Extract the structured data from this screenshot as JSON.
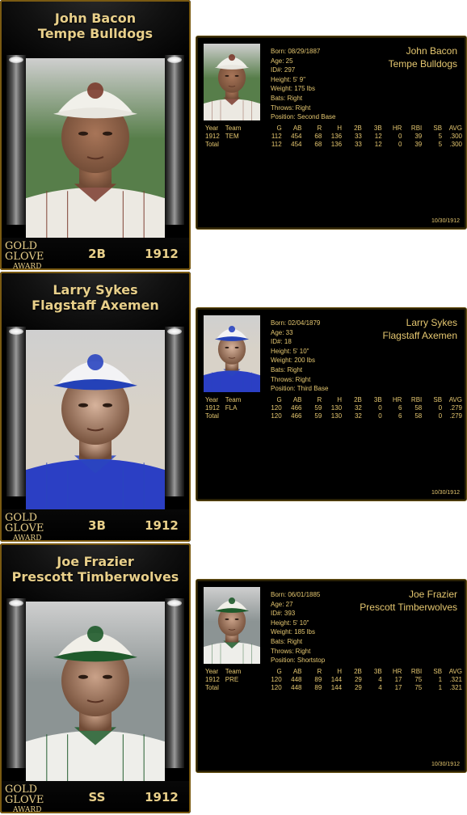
{
  "cards": [
    {
      "name": "John Bacon",
      "team": "Tempe Bulldogs",
      "position": "2B",
      "year": "1912",
      "bio": {
        "born": "Born: 08/29/1887",
        "age": "Age: 25",
        "id": "ID#: 297",
        "height": "Height: 5' 9\"",
        "weight": "Weight: 175 lbs",
        "bats": "Bats: Right",
        "throws": "Throws: Right",
        "position": "Position: Second Base"
      },
      "rows": [
        [
          "1912",
          "TEM",
          "112",
          "454",
          "68",
          "136",
          "33",
          "12",
          "0",
          "39",
          "5",
          ".300"
        ],
        [
          "Total",
          "",
          "112",
          "454",
          "68",
          "136",
          "33",
          "12",
          "0",
          "39",
          "5",
          ".300"
        ]
      ],
      "date": "10/30/1912",
      "colors": {
        "cap": "#f1f0ea",
        "brim": "#e8e6df",
        "jersey": "#ece9e2",
        "pin": "#7b3b2e",
        "skin": "#a87558",
        "bg": "#577e4a"
      }
    },
    {
      "name": "Larry Sykes",
      "team": "Flagstaff Axemen",
      "position": "3B",
      "year": "1912",
      "bio": {
        "born": "Born: 02/04/1879",
        "age": "Age: 33",
        "id": "ID#: 18",
        "height": "Height: 5' 10\"",
        "weight": "Weight: 200 lbs",
        "bats": "Bats: Right",
        "throws": "Throws: Right",
        "position": "Position: Third Base"
      },
      "rows": [
        [
          "1912",
          "FLA",
          "120",
          "466",
          "59",
          "130",
          "32",
          "0",
          "6",
          "58",
          "0",
          ".279"
        ],
        [
          "Total",
          "",
          "120",
          "466",
          "59",
          "130",
          "32",
          "0",
          "6",
          "58",
          "0",
          ".279"
        ]
      ],
      "date": "10/30/1912",
      "colors": {
        "cap": "#f3f3f5",
        "brim": "#2442b8",
        "jersey": "#2b3fc4",
        "pin": "#2a45c0",
        "skin": "#d7b39c",
        "bg": "#d8d2c8"
      }
    },
    {
      "name": "Joe Frazier",
      "team": "Prescott Timberwolves",
      "position": "SS",
      "year": "1912",
      "bio": {
        "born": "Born: 06/01/1885",
        "age": "Age: 27",
        "id": "ID#: 393",
        "height": "Height: 5' 10\"",
        "weight": "Weight: 185 lbs",
        "bats": "Bats: Right",
        "throws": "Throws: Right",
        "position": "Position: Shortstop"
      },
      "rows": [
        [
          "1912",
          "PRE",
          "120",
          "448",
          "89",
          "144",
          "29",
          "4",
          "17",
          "75",
          "1",
          ".321"
        ],
        [
          "Total",
          "",
          "120",
          "448",
          "89",
          "144",
          "29",
          "4",
          "17",
          "75",
          "1",
          ".321"
        ]
      ],
      "date": "10/30/1912",
      "colors": {
        "cap": "#f1efe8",
        "brim": "#1f5a2b",
        "jersey": "#eeeeea",
        "pin": "#1e5a2a",
        "skin": "#caa289",
        "bg": "#8c9494"
      }
    }
  ],
  "headers": [
    "Year",
    "Team",
    "G",
    "AB",
    "R",
    "H",
    "2B",
    "3B",
    "HR",
    "RBI",
    "SB",
    "AVG"
  ],
  "logo": {
    "line1": "GOLD",
    "line2": "GLOVE",
    "line3": "AWARD",
    "color": "#e8cf8a"
  },
  "icons": {
    "player_photo": "player-portrait-icon",
    "award": "gold-glove-logo"
  }
}
